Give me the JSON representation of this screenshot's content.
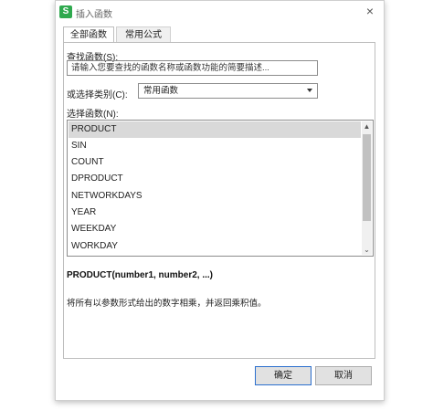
{
  "window": {
    "title": "插入函数",
    "app_icon": "S",
    "close_icon": "×"
  },
  "tabs": [
    {
      "label": "全部函数",
      "active": true
    },
    {
      "label": "常用公式",
      "active": false
    }
  ],
  "search": {
    "label": "查找函数(S):",
    "value": "请输入您要查找的函数名称或函数功能的简要描述..."
  },
  "category": {
    "label": "或选择类别(C):",
    "selected": "常用函数"
  },
  "function_list": {
    "label": "选择函数(N):",
    "items": [
      "PRODUCT",
      "SIN",
      "COUNT",
      "DPRODUCT",
      "NETWORKDAYS",
      "YEAR",
      "WEEKDAY",
      "WORKDAY"
    ],
    "selected_index": 0,
    "scroll_up": "▲",
    "scroll_down": "⌄"
  },
  "signature": "PRODUCT(number1, number2, ...)",
  "description": "将所有以参数形式给出的数字相乘，并返回乘积值。",
  "buttons": {
    "ok": "确定",
    "cancel": "取消"
  }
}
